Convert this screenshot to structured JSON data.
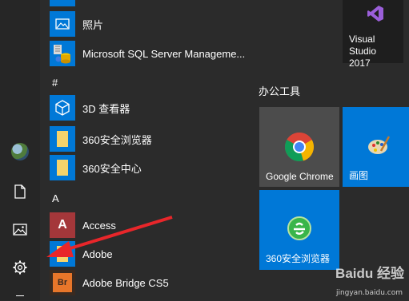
{
  "start_menu": {
    "rail": [
      {
        "name": "user",
        "icon": "user-avatar-icon"
      },
      {
        "name": "documents",
        "icon": "document-icon"
      },
      {
        "name": "pictures",
        "icon": "picture-icon"
      },
      {
        "name": "settings",
        "icon": "gear-icon"
      }
    ],
    "apps": [
      {
        "label": "照片",
        "icon": "photos-icon"
      },
      {
        "label": "Microsoft SQL Server Manageme...",
        "icon": "sql-server-icon"
      },
      {
        "label": "3D 查看器",
        "icon": "3d-viewer-icon"
      },
      {
        "label": "360安全浏览器",
        "icon": "folder-icon",
        "expandable": true
      },
      {
        "label": "360安全中心",
        "icon": "folder-icon",
        "expandable": true
      },
      {
        "label": "Access",
        "icon": "access-icon"
      },
      {
        "label": "Adobe",
        "icon": "folder-icon",
        "expandable": true
      },
      {
        "label": "Adobe Bridge CS5",
        "icon": "adobe-bridge-icon"
      }
    ],
    "letters": {
      "hash": "#",
      "a": "A"
    },
    "access_letter": "A",
    "bridge_text": "Br",
    "tile_group_title": "办公工具",
    "tiles": {
      "visual_studio": {
        "line1": "Visual Studio",
        "line2": "2017",
        "color": "#1e1e1e"
      },
      "chrome": {
        "label": "Google Chrome",
        "color": "#4c4c4c"
      },
      "paint": {
        "label": "画图",
        "color": "#0078d7"
      },
      "browser360": {
        "label": "360安全浏览器",
        "color": "#0078d7"
      }
    },
    "accent": "#0078d7",
    "annotation_arrow_color": "#e8262a"
  },
  "watermark": {
    "brand": "Baidu 经验",
    "url": "jingyan.baidu.com"
  }
}
